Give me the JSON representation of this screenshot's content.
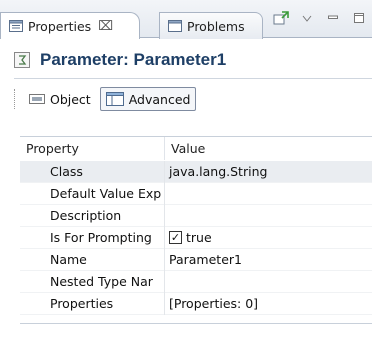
{
  "tabs": {
    "properties_label": "Properties",
    "properties_close": "⌧",
    "problems_label": "Problems"
  },
  "title": {
    "text": "Parameter: Parameter1"
  },
  "subtabs": {
    "object_label": "Object",
    "advanced_label": "Advanced",
    "selected": "Advanced"
  },
  "table": {
    "headers": {
      "property": "Property",
      "value": "Value"
    },
    "rows": [
      {
        "property": "Class",
        "value": "java.lang.String",
        "selected": true
      },
      {
        "property": "Default Value Exp",
        "value": ""
      },
      {
        "property": "Description",
        "value": ""
      },
      {
        "property": "Is For Prompting",
        "value": "true",
        "checkbox": true,
        "checked": true
      },
      {
        "property": "Name",
        "value": "Parameter1"
      },
      {
        "property": "Nested Type Nar",
        "value": ""
      },
      {
        "property": "Properties",
        "value": "[Properties: 0]"
      }
    ]
  },
  "colors": {
    "title": "#1e3f66",
    "selected_row": "#eaedf1",
    "tab_border": "#a9b4c4"
  },
  "icons": {
    "properties_tab": "properties-icon",
    "problems_tab": "problems-icon",
    "pin": "pin-icon",
    "view_menu": "chevron-down-icon",
    "minimize": "minimize-icon",
    "maximize": "maximize-icon",
    "parameter": "parameter-icon"
  }
}
